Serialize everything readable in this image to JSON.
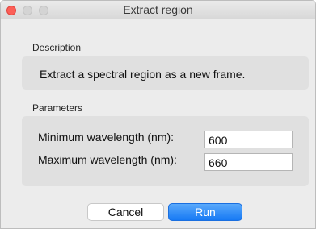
{
  "window": {
    "title": "Extract region"
  },
  "description": {
    "group_label": "Description",
    "text": "Extract a spectral region as a new frame."
  },
  "parameters": {
    "group_label": "Parameters",
    "fields": [
      {
        "label": "Minimum wavelength (nm):",
        "value": "600"
      },
      {
        "label": "Maximum wavelength (nm):",
        "value": "660"
      }
    ]
  },
  "buttons": {
    "cancel_label": "Cancel",
    "run_label": "Run"
  },
  "colors": {
    "close_button": "#fc5f57",
    "primary_button": "#1679f4",
    "panel_background": "#e0e0e0",
    "window_background": "#ececec"
  },
  "icons": [
    "close-traffic-light",
    "minimize-traffic-light",
    "maximize-traffic-light"
  ]
}
